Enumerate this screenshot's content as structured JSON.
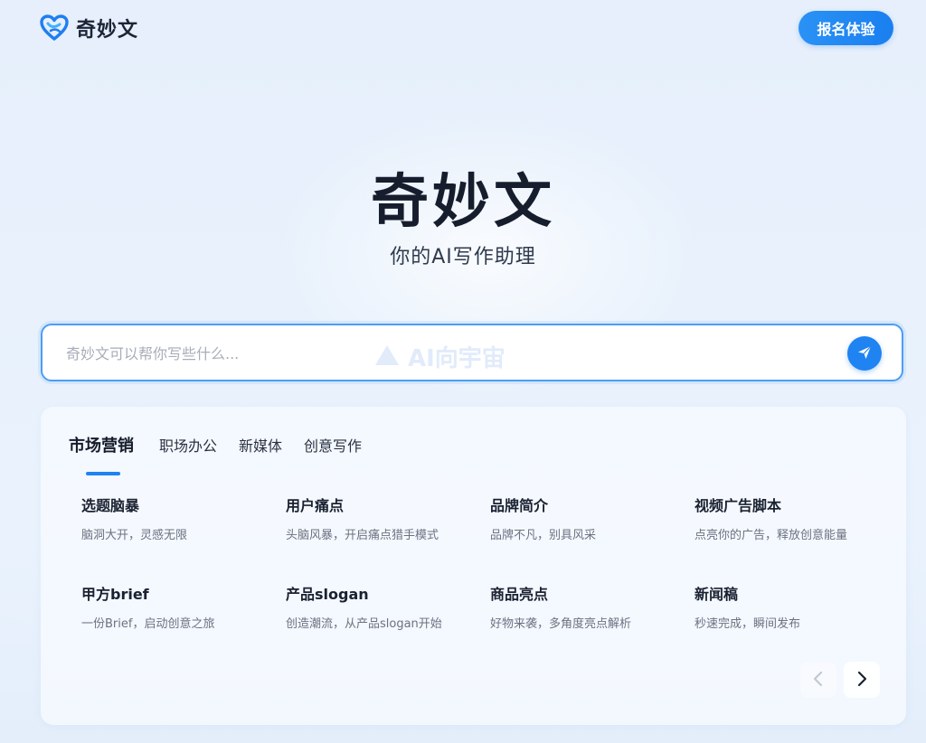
{
  "header": {
    "app_name": "奇妙文",
    "signup_label": "报名体验"
  },
  "hero": {
    "title": "奇妙文",
    "subtitle": "你的AI写作助理"
  },
  "search": {
    "placeholder": "奇妙文可以帮你写些什么...",
    "watermark": "AI向宇宙"
  },
  "tabs": [
    {
      "label": "市场营销",
      "active": true
    },
    {
      "label": "职场办公",
      "active": false
    },
    {
      "label": "新媒体",
      "active": false
    },
    {
      "label": "创意写作",
      "active": false
    }
  ],
  "items": [
    {
      "title": "选题脑暴",
      "desc": "脑洞大开，灵感无限"
    },
    {
      "title": "用户痛点",
      "desc": "头脑风暴，开启痛点猎手模式"
    },
    {
      "title": "品牌简介",
      "desc": "品牌不凡，别具风采"
    },
    {
      "title": "视频广告脚本",
      "desc": "点亮你的广告，释放创意能量"
    },
    {
      "title": "甲方brief",
      "desc": "一份Brief，启动创意之旅"
    },
    {
      "title": "产品slogan",
      "desc": "创造潮流，从产品slogan开始"
    },
    {
      "title": "商品亮点",
      "desc": "好物来袭，多角度亮点解析"
    },
    {
      "title": "新闻稿",
      "desc": "秒速完成，瞬间发布"
    }
  ],
  "icons": {
    "logo": "heart-logo-icon",
    "send": "send-arrow-icon",
    "prev": "chevron-left-icon",
    "next": "chevron-right-icon"
  },
  "colors": {
    "accent": "#1f83f2",
    "title": "#161e2e",
    "muted": "#6b7280"
  }
}
